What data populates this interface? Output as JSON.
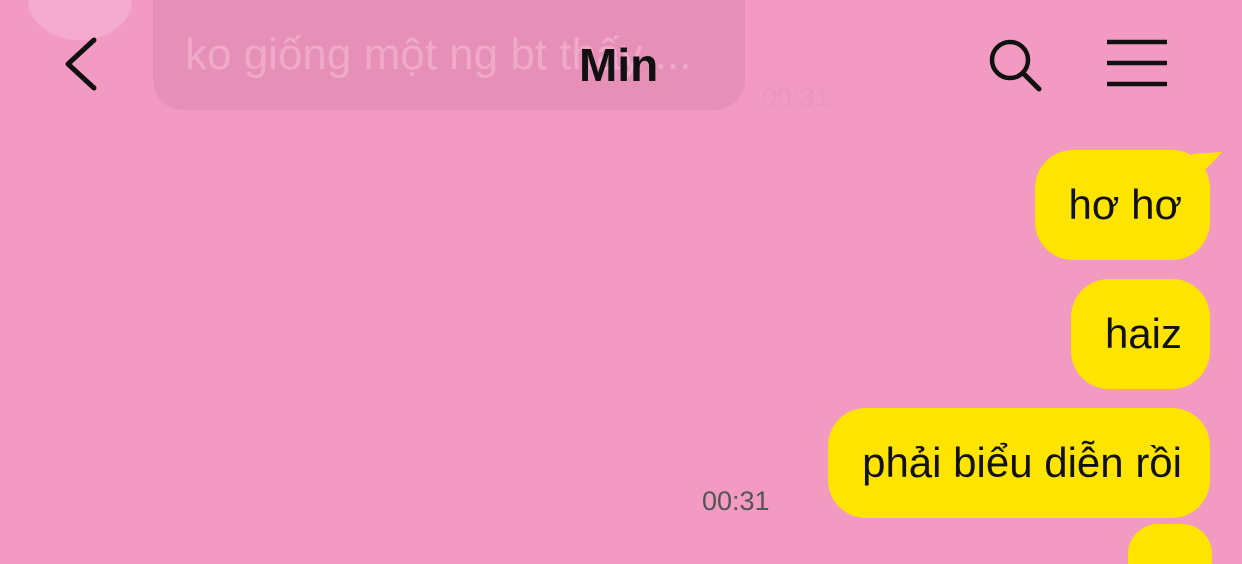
{
  "header": {
    "title": "Min",
    "back_icon": "chevron-left-icon",
    "search_icon": "search-icon",
    "menu_icon": "hamburger-menu-icon"
  },
  "previous_message": {
    "text": "ko giống một ng bt thấy ...",
    "time": "00:31"
  },
  "messages": [
    {
      "text": "hơ hơ"
    },
    {
      "text": "haiz"
    },
    {
      "text": "phải biểu diễn rồi"
    }
  ],
  "group_time": "00:31",
  "colors": {
    "background": "#F29AC2",
    "outgoing_bubble": "#FFE400",
    "text": "#111111",
    "timestamp": "#555555"
  }
}
